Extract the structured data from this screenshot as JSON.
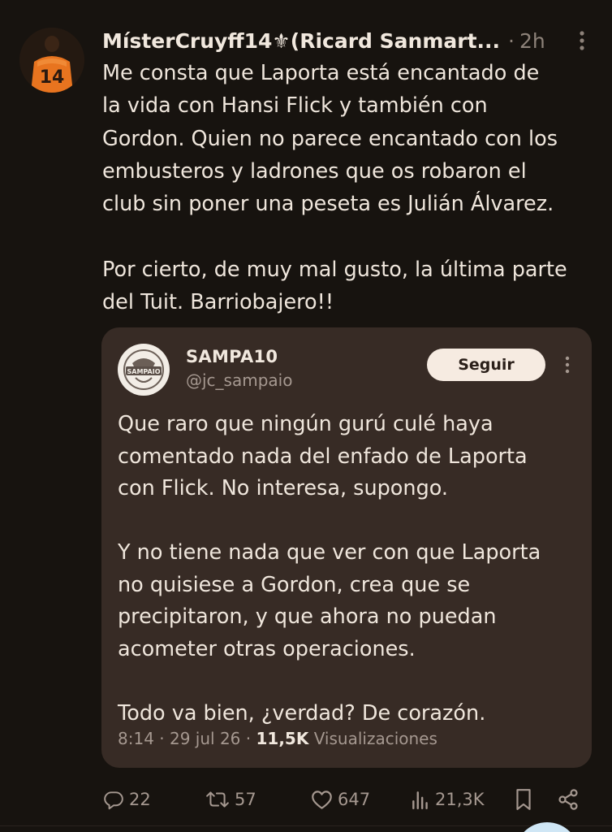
{
  "tweet": {
    "author_name": "MísterCruyff14⚜(Ricard Sanmart...",
    "separator": "·",
    "time": "2h",
    "avatar_jersey_number": "14",
    "text_lines_1": [
      "Me consta que Laporta está encantado de",
      "la vida con Hansi Flick y también con",
      "Gordon. Quien no parece encantado con los",
      "embusteros y ladrones que os robaron el",
      "club sin poner una peseta es Julián Álvarez."
    ],
    "text_lines_2": [
      "Por cierto, de muy mal gusto, la última parte",
      "del Tuit. Barriobajero!!"
    ]
  },
  "quote": {
    "name": "SAMPA10",
    "handle": "@jc_sampaio",
    "follow_label": "Seguir",
    "avatar_badge_text": "SAMPAIO",
    "paragraph_1": [
      "Que raro que ningún gurú culé haya",
      "comentado nada del enfado de Laporta",
      "con Flick. No interesa, supongo."
    ],
    "paragraph_2": [
      "Y no tiene nada que ver con que Laporta",
      "no quisiese a Gordon, crea que se",
      "precipitaron, y que ahora no puedan",
      "acometer otras operaciones."
    ],
    "paragraph_3": [
      "Todo va bien, ¿verdad? De corazón."
    ],
    "time": "8:14",
    "date": "29 jul 26",
    "views_count": "11,5K",
    "views_label": "Visualizaciones"
  },
  "actions": {
    "replies": "22",
    "reposts": "57",
    "likes": "647",
    "views": "21,3K"
  },
  "colors": {
    "background": "#17130f",
    "quote_card": "#372b25",
    "text": "#efe6dc",
    "muted": "#a59890",
    "avatar_jersey": "#e8741f",
    "follow_button": "#f6ebe1"
  }
}
